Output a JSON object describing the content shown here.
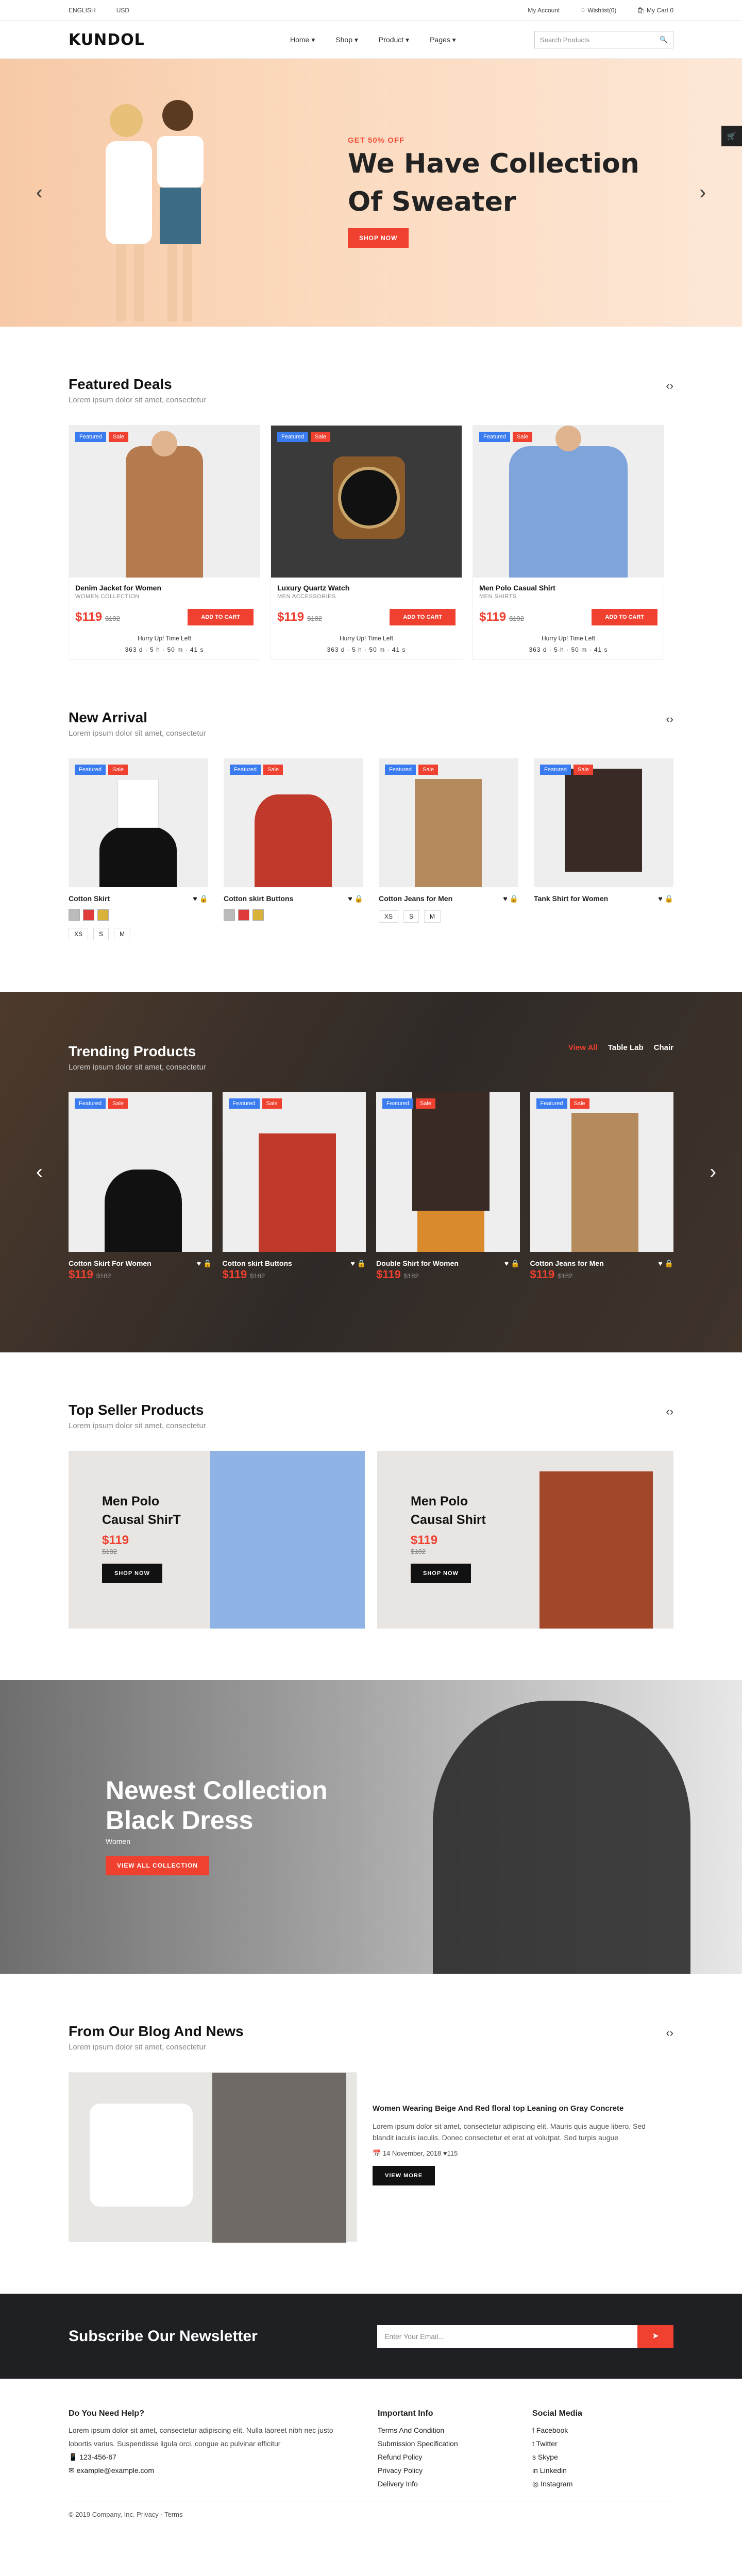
{
  "topbar": {
    "lang": "ENGLISH",
    "currency": "USD",
    "account": "My Account",
    "wishlist": "Wishlist(0)",
    "cart": "My Cart 0"
  },
  "nav": {
    "logo": "KUNDOL",
    "items": [
      "Home",
      "Shop",
      "Product",
      "Pages"
    ],
    "search_placeholder": "Search Products"
  },
  "hero": {
    "tag": "GET 50% OFF",
    "title1": "We Have Collection",
    "title2": "Of Sweater",
    "button": "SHOP NOW"
  },
  "featured": {
    "title": "Featured Deals",
    "subtitle": "Lorem ipsum dolor sit amet, consectetur",
    "cards": [
      {
        "name": "Denim Jacket for Women",
        "cat": "WOMEN COLLECTION",
        "price": "$119",
        "old": "$182",
        "hurry": "Hurry Up! Time Left",
        "cd": "363 d · 5 h · 50 m · 41 s",
        "add": "ADD TO CART",
        "featured": "Featured",
        "sale": "Sale"
      },
      {
        "name": "Luxury Quartz Watch",
        "cat": "MEN ACCESSORIES",
        "price": "$119",
        "old": "$182",
        "hurry": "Hurry Up! Time Left",
        "cd": "363 d · 5 h · 50 m · 41 s",
        "add": "ADD TO CART",
        "featured": "Featured",
        "sale": "Sale"
      },
      {
        "name": "Men Polo Casual Shirt",
        "cat": "MEN SHIRTS",
        "price": "$119",
        "old": "$182",
        "hurry": "Hurry Up! Time Left",
        "cd": "363 d · 5 h · 50 m · 41 s",
        "add": "ADD TO CART",
        "featured": "Featured",
        "sale": "Sale"
      }
    ]
  },
  "arrival": {
    "title": "New Arrival",
    "subtitle": "Lorem ipsum dolor sit amet, consectetur",
    "items": [
      {
        "name": "Cotton Skirt",
        "featured": "Featured",
        "sale": "Sale"
      },
      {
        "name": "Cotton skirt Buttons",
        "featured": "Featured",
        "sale": "Sale"
      },
      {
        "name": "Cotton Jeans for Men",
        "featured": "Featured",
        "sale": "Sale"
      },
      {
        "name": "Tank Shirt for Women",
        "featured": "Featured",
        "sale": "Sale"
      }
    ],
    "sizes": [
      "XS",
      "S",
      "M"
    ]
  },
  "trending": {
    "title": "Trending Products",
    "subtitle": "Lorem ipsum dolor sit amet, consectetur",
    "tabs": [
      "View All",
      "Table Lab",
      "Chair"
    ],
    "items": [
      {
        "name": "Cotton Skirt For Women",
        "price": "$119",
        "old": "$182",
        "featured": "Featured",
        "sale": "Sale"
      },
      {
        "name": "Cotton skirt Buttons",
        "price": "$119",
        "old": "$182",
        "featured": "Featured",
        "sale": "Sale"
      },
      {
        "name": "Double Shirt for Women",
        "price": "$119",
        "old": "$182",
        "featured": "Featured",
        "sale": "Sale"
      },
      {
        "name": "Cotton Jeans for Men",
        "price": "$119",
        "old": "$182",
        "featured": "Featured",
        "sale": "Sale"
      }
    ]
  },
  "topseller": {
    "title": "Top Seller Products",
    "subtitle": "Lorem ipsum dolor sit amet, consectetur",
    "items": [
      {
        "l1": "Men Polo",
        "l2": "Causal ShirT",
        "price": "$119",
        "old": "$182",
        "btn": "SHOP NOW"
      },
      {
        "l1": "Men Polo",
        "l2": "Causal Shirt",
        "price": "$119",
        "old": "$182",
        "btn": "SHOP NOW"
      }
    ]
  },
  "banner": {
    "t1": "Newest Collection",
    "t2": "Black Dress",
    "sub": "Women",
    "btn": "VIEW ALL COLLECTION"
  },
  "blog": {
    "title": "From Our Blog And News",
    "subtitle": "Lorem ipsum dolor sit amet, consectetur",
    "post_title": "Women Wearing Beige And Red floral top Leaning on Gray Concrete",
    "body": "Lorem ipsum dolor sit amet, consectetur adipiscing elit. Mauris quis augue libero. Sed blandit iaculis iaculis. Donec consectetur et erat at volutpat. Sed turpis augue",
    "date": "14 November, 2018",
    "likes": "115",
    "btn": "VIEW MORE"
  },
  "newsletter": {
    "title": "Subscribe Our Newsletter",
    "placeholder": "Enter Your Email..."
  },
  "footer": {
    "help_title": "Do You Need Help?",
    "help_text": "Lorem ipsum dolor sit amet, consectetur adipiscing elit. Nulla laoreet nibh nec justo lobortis varius. Suspendisse ligula orci, congue ac pulvinar efficitur",
    "phone": "123-456-67",
    "email": "example@example.com",
    "info_title": "Important Info",
    "info": [
      "Terms And Condition",
      "Submission Specification",
      "Refund Policy",
      "Privacy Policy",
      "Delivery Info"
    ],
    "social_title": "Social Media",
    "social": [
      "Facebook",
      "Twitter",
      "Skype",
      "Linkedin",
      "Instagram"
    ],
    "copy": "© 2019 Company, Inc. Privacy · Terms"
  }
}
